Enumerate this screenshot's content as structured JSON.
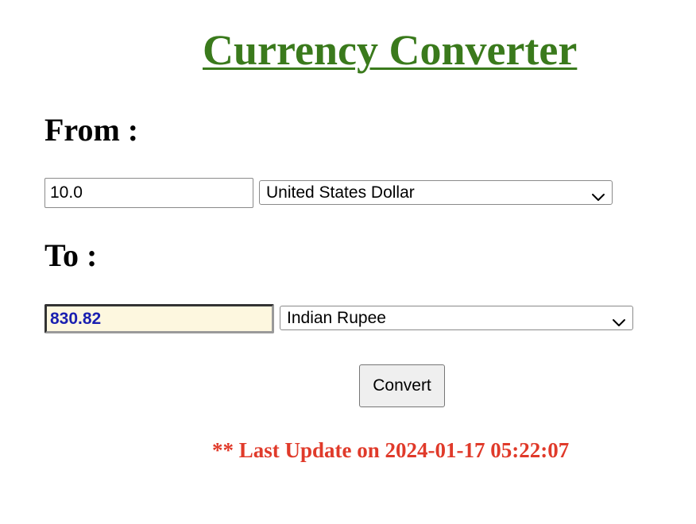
{
  "page": {
    "title": "Currency Converter"
  },
  "from": {
    "label": "From :",
    "amount": "10.0",
    "currency": "United States Dollar"
  },
  "to": {
    "label": "To :",
    "amount": "830.82",
    "currency": "Indian Rupee"
  },
  "convert_button": {
    "label": "Convert"
  },
  "status": {
    "last_update": "** Last Update on 2024-01-17 05:22:07"
  },
  "colors": {
    "title": "#3a7a1c",
    "last_update": "#e03a2a",
    "result_text": "#1a1fb0",
    "result_background": "#fdf7df"
  },
  "icons": {
    "dropdown": "chevron-down-icon"
  }
}
